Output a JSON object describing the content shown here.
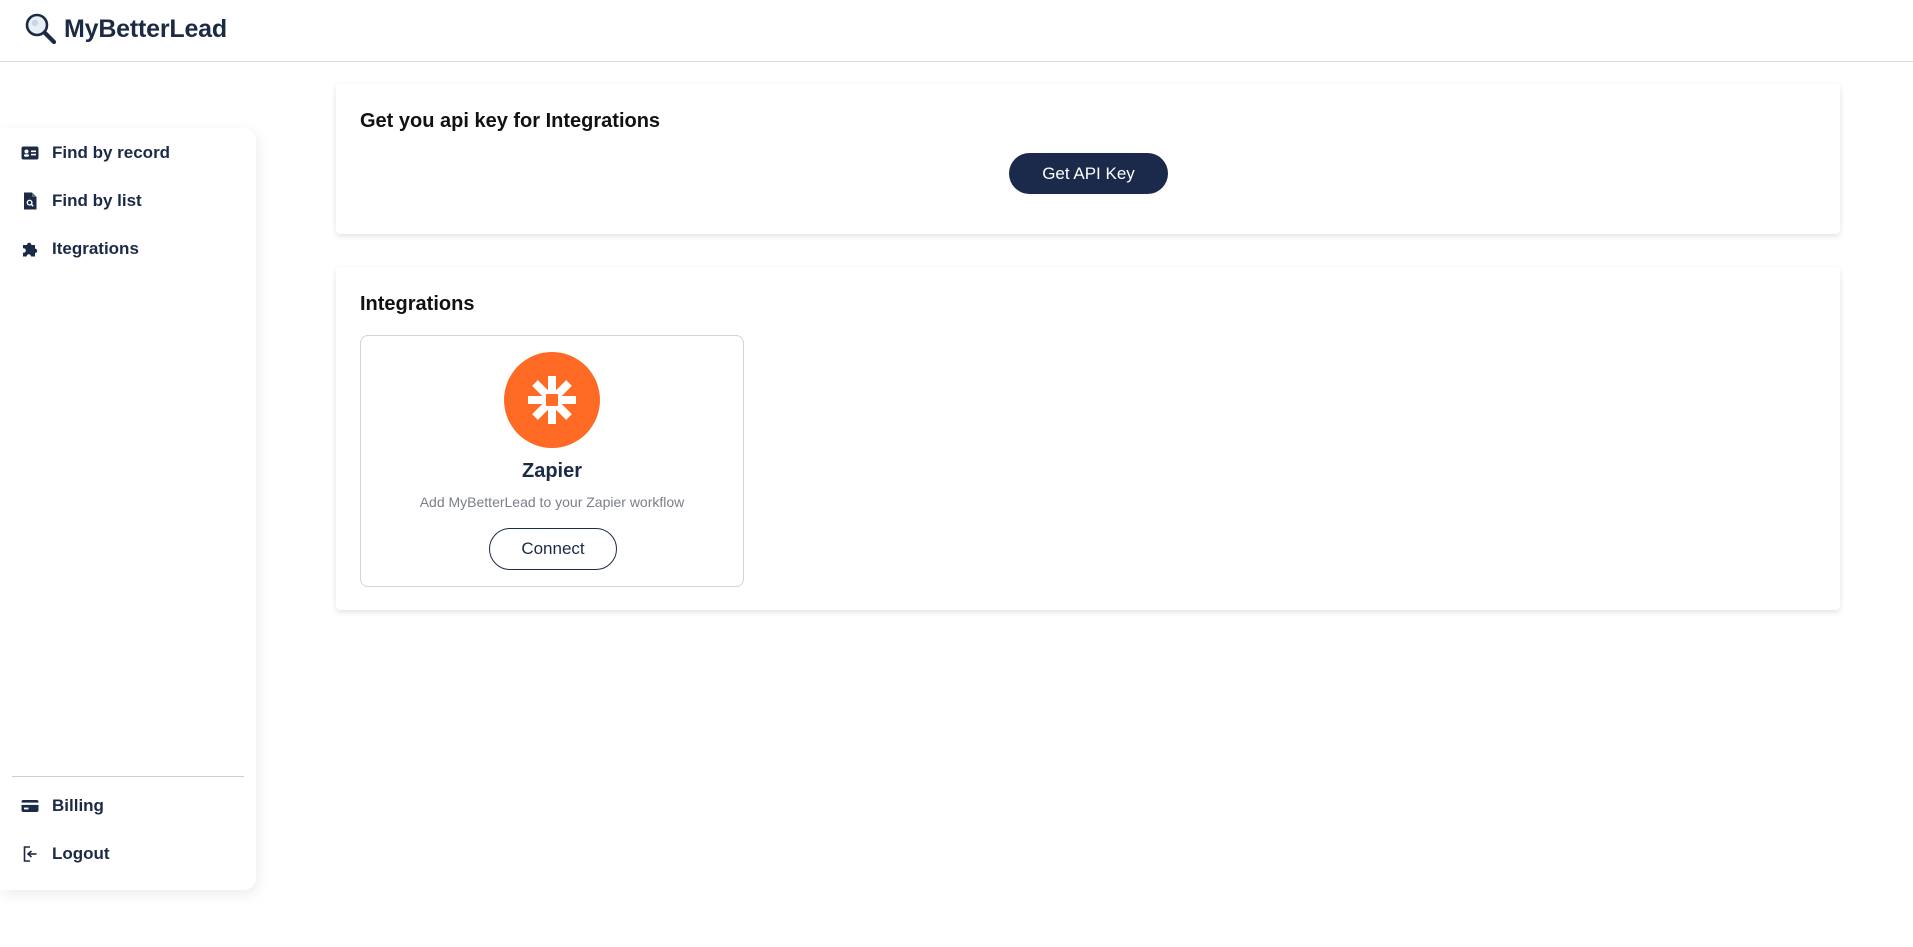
{
  "brand": {
    "name": "MyBetterLead",
    "icon": "magnifier-logo-icon"
  },
  "sidebar": {
    "items": [
      {
        "label": "Find by record",
        "icon": "id-card-icon"
      },
      {
        "label": "Find by list",
        "icon": "file-search-icon"
      },
      {
        "label": "Itegrations",
        "icon": "puzzle-icon"
      }
    ],
    "bottom_items": [
      {
        "label": "Billing",
        "icon": "credit-card-icon"
      },
      {
        "label": "Logout",
        "icon": "logout-icon"
      }
    ]
  },
  "api_card": {
    "title": "Get you api key for Integrations",
    "button_label": "Get API Key"
  },
  "integrations_card": {
    "title": "Integrations",
    "items": [
      {
        "name": "Zapier",
        "description": "Add MyBetterLead to your Zapier workflow",
        "button_label": "Connect",
        "icon": "zapier-asterisk-icon",
        "brand_color": "#ff6a24"
      }
    ]
  },
  "colors": {
    "primary": "#1b2a4a",
    "text": "#1b2a45",
    "muted": "#7a7f88",
    "zapier": "#ff6a24"
  }
}
